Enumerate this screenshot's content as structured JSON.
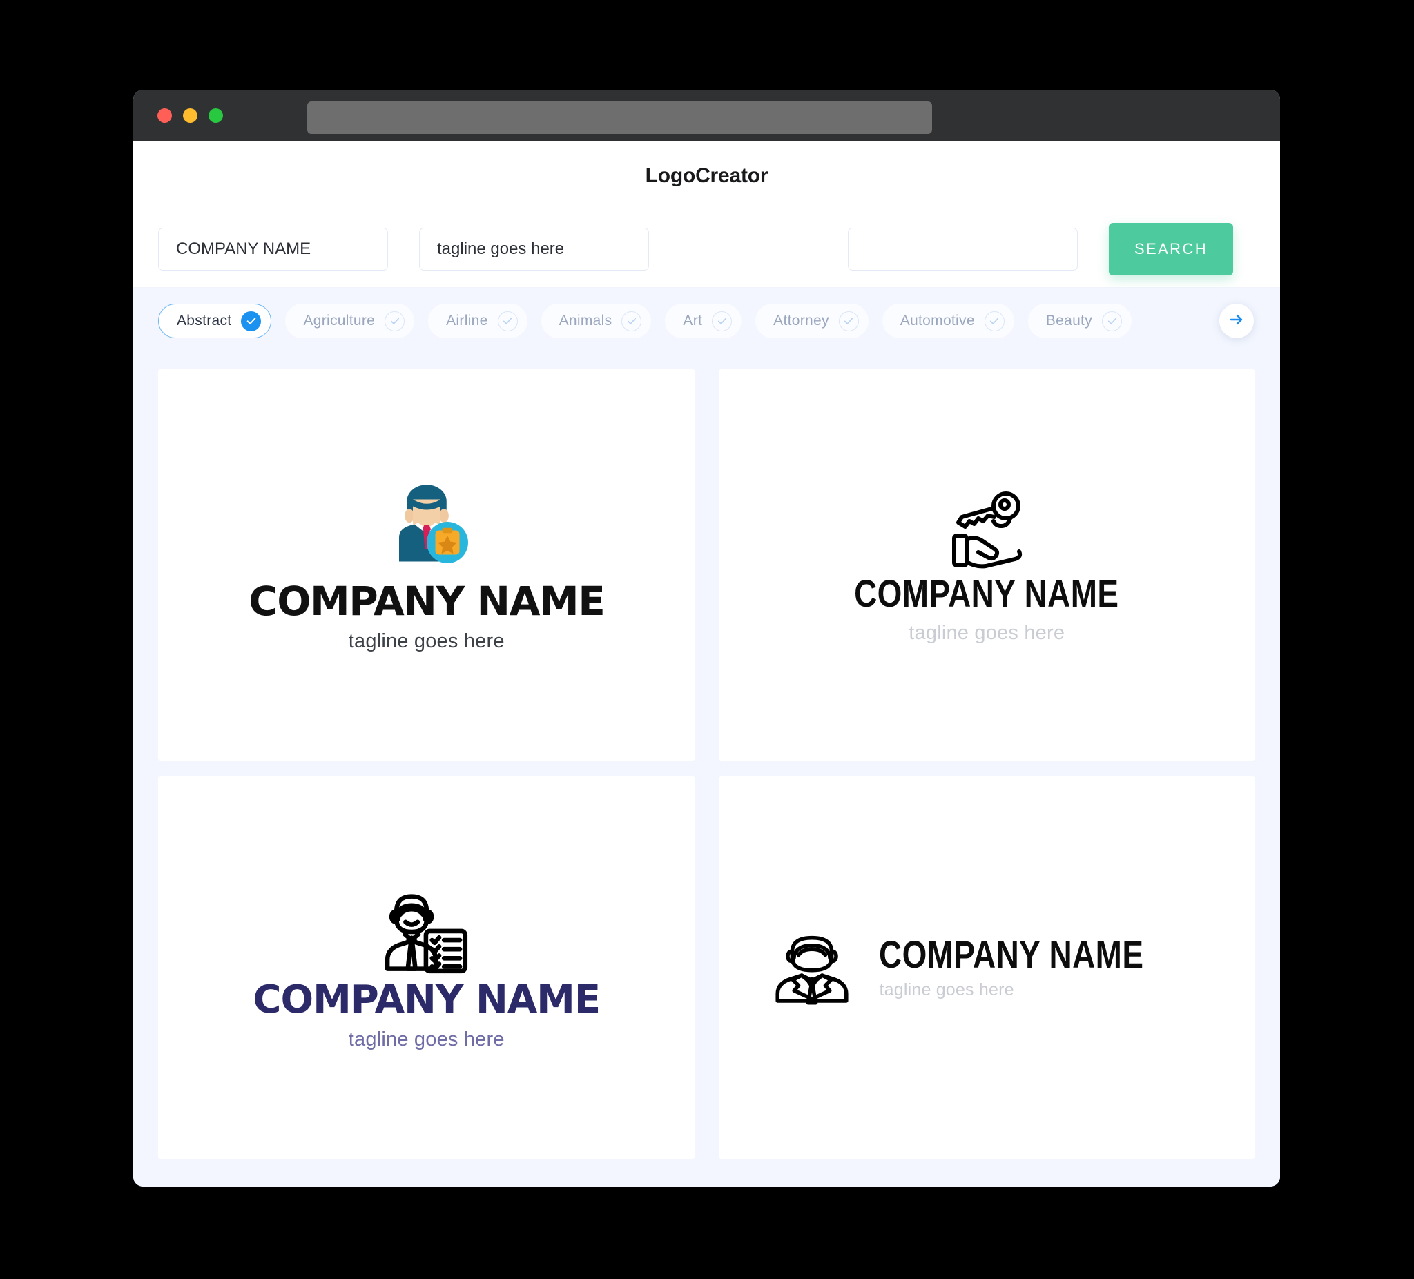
{
  "browser": {
    "traffic_lights": [
      "close-red",
      "minimize-yellow",
      "maximize-green"
    ],
    "url_value": ""
  },
  "header": {
    "title": "LogoCreator"
  },
  "search": {
    "company_value": "COMPANY NAME",
    "company_placeholder": "COMPANY NAME",
    "tagline_value": "tagline goes here",
    "tagline_placeholder": "tagline goes here",
    "extra_value": "",
    "extra_placeholder": "",
    "search_label": "SEARCH",
    "search_color": "#4ecb9e"
  },
  "categories": {
    "next_icon": "arrow-right-icon",
    "accent_selected": "#1b92f0",
    "items": [
      {
        "label": "Abstract",
        "selected": true
      },
      {
        "label": "Agriculture",
        "selected": false
      },
      {
        "label": "Airline",
        "selected": false
      },
      {
        "label": "Animals",
        "selected": false
      },
      {
        "label": "Art",
        "selected": false
      },
      {
        "label": "Attorney",
        "selected": false
      },
      {
        "label": "Automotive",
        "selected": false
      },
      {
        "label": "Beauty",
        "selected": false
      }
    ]
  },
  "results": [
    {
      "icon": "businessman-badge-icon",
      "layout": "stacked",
      "name": "COMPANY NAME",
      "tagline": "tagline goes here",
      "name_color": "#111111",
      "tagline_color": "#3d4148"
    },
    {
      "icon": "hand-holding-key-icon",
      "layout": "stacked",
      "name": "COMPANY NAME",
      "tagline": "tagline goes here",
      "name_color": "#0d0d0d",
      "tagline_color": "#c9ccd2"
    },
    {
      "icon": "man-with-checklist-icon",
      "layout": "stacked",
      "name": "COMPANY NAME",
      "tagline": "tagline goes here",
      "name_color": "#2c2a68",
      "tagline_color": "#6f6ca6"
    },
    {
      "icon": "businessman-outline-icon",
      "layout": "horizontal",
      "name": "COMPANY NAME",
      "tagline": "tagline goes here",
      "name_color": "#0d0d0d",
      "tagline_color": "#c9ccd2"
    }
  ]
}
